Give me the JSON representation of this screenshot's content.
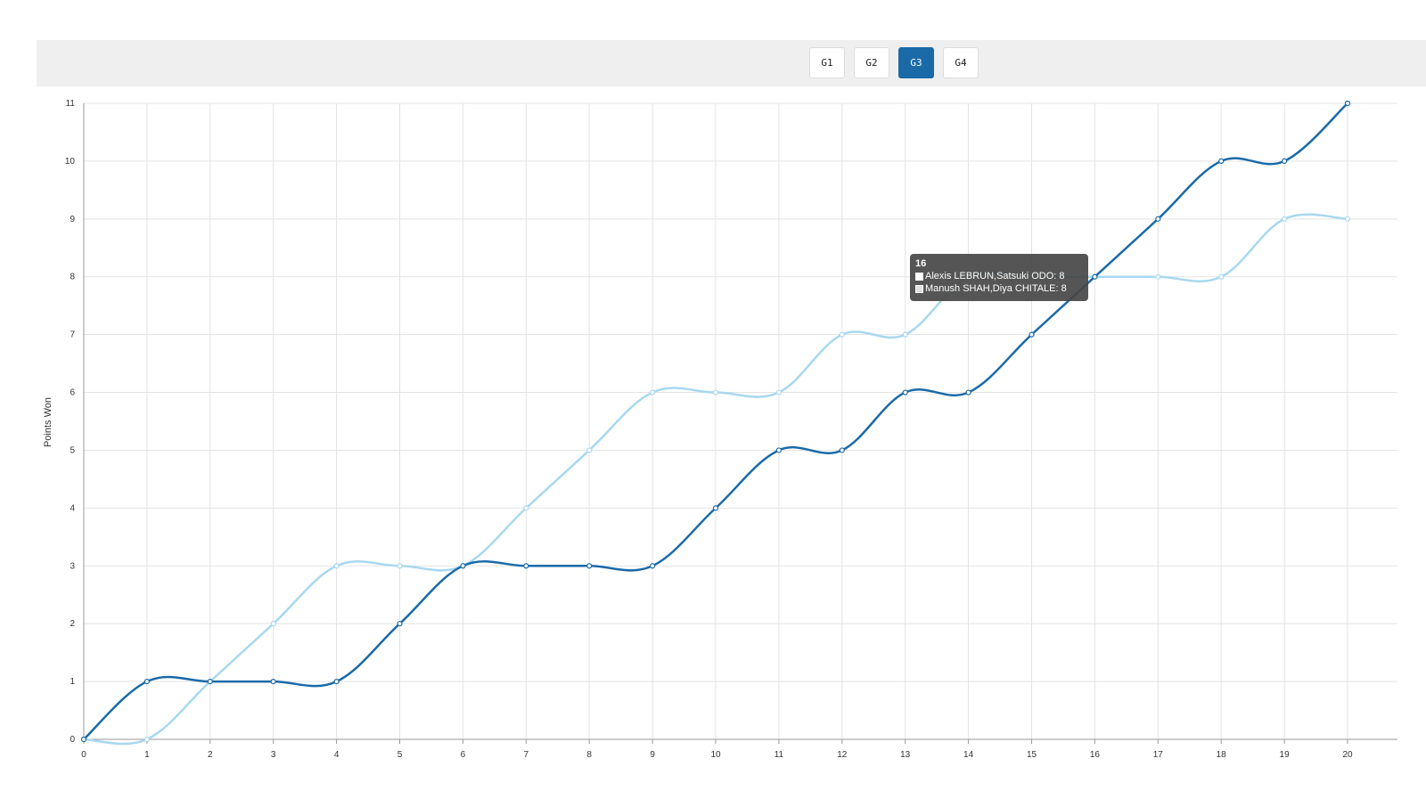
{
  "game_tabs": {
    "items": [
      {
        "label": "G1",
        "active": false
      },
      {
        "label": "G2",
        "active": false
      },
      {
        "label": "G3",
        "active": true
      },
      {
        "label": "G4",
        "active": false
      }
    ]
  },
  "tooltip": {
    "title": "16",
    "rows": [
      {
        "text": "Alexis LEBRUN,Satsuki ODO: 8",
        "color": "#ffffff"
      },
      {
        "text": "Manush SHAH,Diya CHITALE: 8",
        "color": "#e0e0e0"
      }
    ]
  },
  "colors": {
    "accent": "#1a6aa8",
    "series_dark": "#1a6aa8",
    "series_light": "#a8d8f0",
    "grid": "#e3e3e3",
    "game_bar_bg": "#efefef"
  },
  "chart_data": {
    "type": "line",
    "ylabel": "Points Won",
    "xlabel": "",
    "x": [
      0,
      1,
      2,
      3,
      4,
      5,
      6,
      7,
      8,
      9,
      10,
      11,
      12,
      13,
      14,
      15,
      16,
      17,
      18,
      19,
      20
    ],
    "xlim": [
      0,
      20
    ],
    "ylim": [
      0,
      11
    ],
    "grid": true,
    "series": [
      {
        "name": "Alexis LEBRUN,Satsuki ODO",
        "color": "#1a6aa8",
        "values": [
          0,
          1,
          1,
          1,
          1,
          2,
          3,
          3,
          3,
          3,
          4,
          5,
          5,
          6,
          6,
          7,
          8,
          9,
          10,
          10,
          11
        ]
      },
      {
        "name": "Manush SHAH,Diya CHITALE",
        "color": "#a8d8f0",
        "values": [
          0,
          0,
          1,
          2,
          3,
          3,
          3,
          4,
          5,
          6,
          6,
          6,
          7,
          7,
          8,
          8,
          8,
          8,
          8,
          9,
          9
        ]
      }
    ]
  }
}
